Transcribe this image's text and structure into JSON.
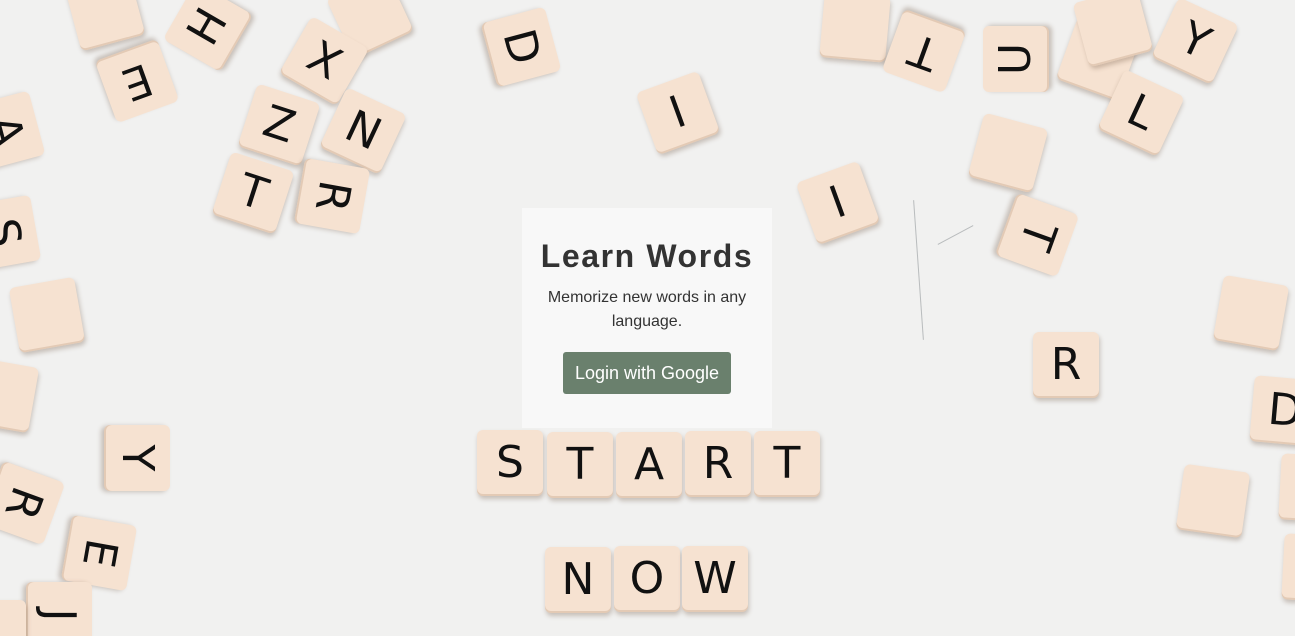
{
  "card": {
    "title": "Learn Words",
    "subtitle": "Memorize new words in any language.",
    "login_label": "Login with Google",
    "button_color": "#6a806d"
  },
  "background": {
    "start_word": [
      "S",
      "T",
      "A",
      "R",
      "T"
    ],
    "now_word": [
      "N",
      "O",
      "W"
    ],
    "scattered_letters": [
      "H",
      "E",
      "X",
      "Z",
      "N",
      "T",
      "R",
      "D",
      "I",
      "I",
      "T",
      "U",
      "Y",
      "L",
      "T",
      "R",
      "Y",
      "R",
      "E",
      "J",
      "A",
      "S",
      "D"
    ]
  }
}
